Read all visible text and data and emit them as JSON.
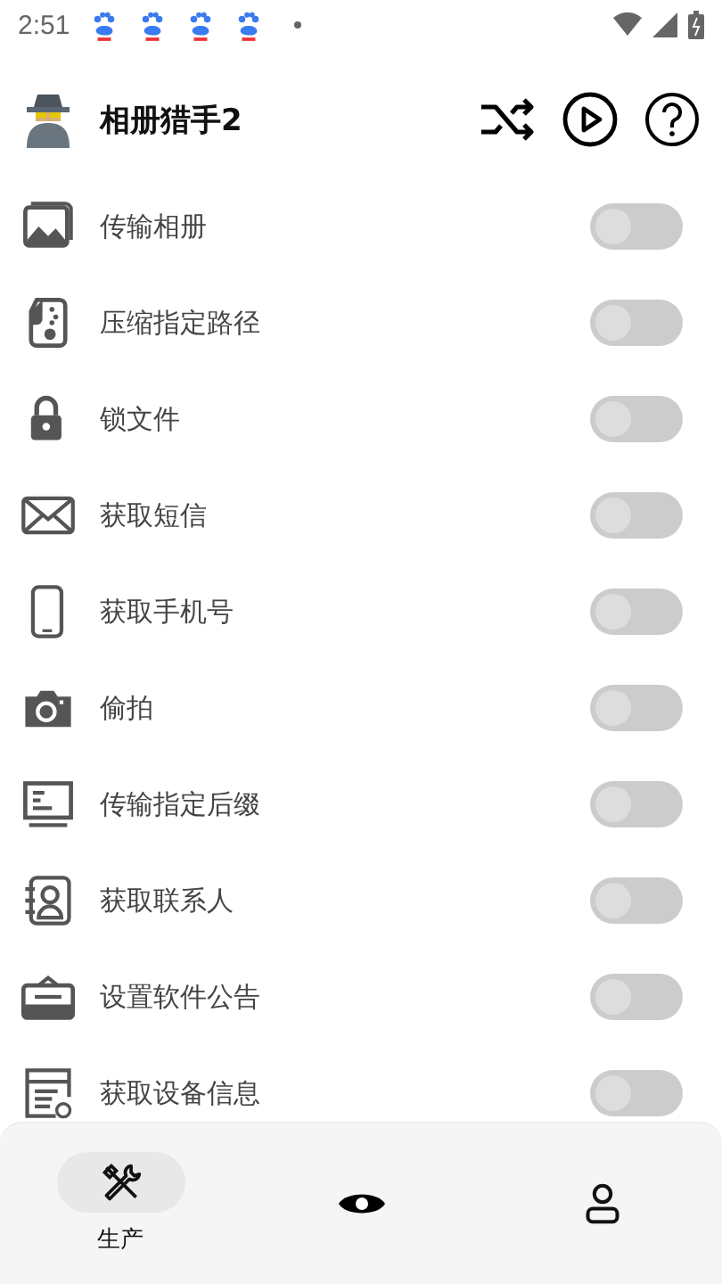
{
  "status_bar": {
    "time": "2:51"
  },
  "app_bar": {
    "title": "相册猎手2"
  },
  "items": [
    {
      "label": "传输相册",
      "on": false
    },
    {
      "label": "压缩指定路径",
      "on": false
    },
    {
      "label": "锁文件",
      "on": false
    },
    {
      "label": "获取短信",
      "on": false
    },
    {
      "label": "获取手机号",
      "on": false
    },
    {
      "label": "偷拍",
      "on": false
    },
    {
      "label": "传输指定后缀",
      "on": false
    },
    {
      "label": "获取联系人",
      "on": false
    },
    {
      "label": "设置软件公告",
      "on": false
    },
    {
      "label": "获取设备信息",
      "on": false
    }
  ],
  "nav": [
    {
      "label": "生产",
      "selected": true
    },
    {
      "selected": false
    },
    {
      "selected": false
    }
  ]
}
